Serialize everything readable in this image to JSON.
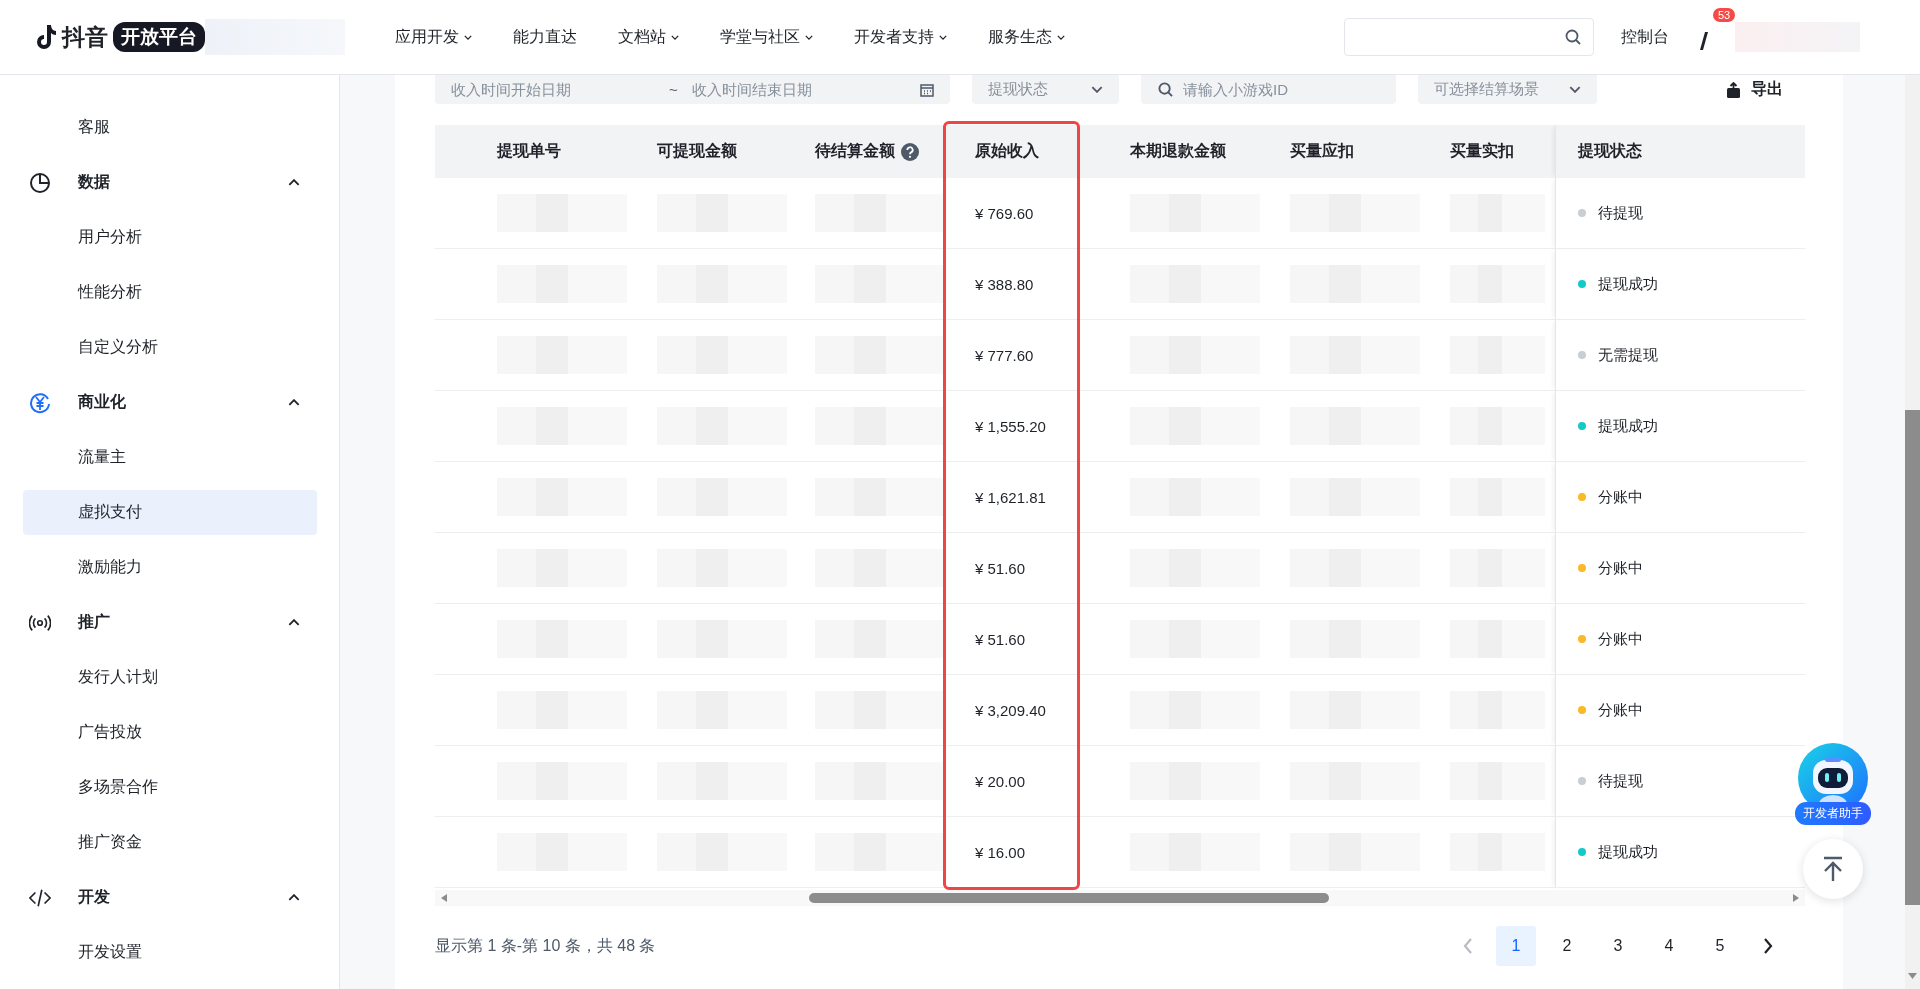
{
  "header": {
    "logo": {
      "name": "抖音",
      "badge": "开放平台"
    },
    "nav": [
      {
        "label": "应用开发",
        "dropdown": true
      },
      {
        "label": "能力直达",
        "dropdown": false
      },
      {
        "label": "文档站",
        "dropdown": true
      },
      {
        "label": "学堂与社区",
        "dropdown": true
      },
      {
        "label": "开发者支持",
        "dropdown": true
      },
      {
        "label": "服务生态",
        "dropdown": true
      }
    ],
    "console": "控制台",
    "notification_count": "53"
  },
  "sidebar": {
    "items": [
      {
        "kind": "item",
        "label": "客服",
        "selected": false
      },
      {
        "kind": "group",
        "label": "数据",
        "expanded": true
      },
      {
        "kind": "item",
        "label": "用户分析",
        "selected": false
      },
      {
        "kind": "item",
        "label": "性能分析",
        "selected": false
      },
      {
        "kind": "item",
        "label": "自定义分析",
        "selected": false
      },
      {
        "kind": "group",
        "label": "商业化",
        "expanded": true
      },
      {
        "kind": "item",
        "label": "流量主",
        "selected": false
      },
      {
        "kind": "item",
        "label": "虚拟支付",
        "selected": true
      },
      {
        "kind": "item",
        "label": "激励能力",
        "selected": false
      },
      {
        "kind": "group",
        "label": "推广",
        "expanded": true
      },
      {
        "kind": "item",
        "label": "发行人计划",
        "selected": false
      },
      {
        "kind": "item",
        "label": "广告投放",
        "selected": false
      },
      {
        "kind": "item",
        "label": "多场景合作",
        "selected": false
      },
      {
        "kind": "item",
        "label": "推广资金",
        "selected": false
      },
      {
        "kind": "group",
        "label": "开发",
        "expanded": true
      },
      {
        "kind": "item",
        "label": "开发设置",
        "selected": false
      }
    ]
  },
  "filters": {
    "start_date": {
      "placeholder": "收入时间开始日期"
    },
    "separator": "~",
    "end_date": {
      "placeholder": "收入时间结束日期"
    },
    "status_select": {
      "placeholder": "提现状态"
    },
    "game_search": {
      "placeholder": "请输入小游戏ID"
    },
    "scene_select": {
      "placeholder": "可选择结算场景"
    },
    "export": "导出"
  },
  "table": {
    "columns": [
      {
        "label": "提现单号",
        "kind": "hidden",
        "help": false,
        "highlighted": false
      },
      {
        "label": "可提现金额",
        "kind": "hidden",
        "help": false,
        "highlighted": false
      },
      {
        "label": "待结算金额",
        "kind": "hidden",
        "help": true,
        "highlighted": false
      },
      {
        "label": "原始收入",
        "kind": "amount",
        "help": false,
        "highlighted": true
      },
      {
        "label": "本期退款金额",
        "kind": "hidden",
        "help": false,
        "highlighted": false
      },
      {
        "label": "买量应扣",
        "kind": "hidden",
        "help": false,
        "highlighted": false
      },
      {
        "label": "买量实扣",
        "kind": "hidden",
        "help": false,
        "highlighted": false
      },
      {
        "label": "提现状态",
        "kind": "status",
        "help": false,
        "highlighted": false
      }
    ],
    "rows": [
      {
        "amount": "¥ 769.60",
        "status": "待提现",
        "color": "#c9cdd4"
      },
      {
        "amount": "¥ 388.80",
        "status": "提现成功",
        "color": "#14c9c9"
      },
      {
        "amount": "¥ 777.60",
        "status": "无需提现",
        "color": "#c9cdd4"
      },
      {
        "amount": "¥ 1,555.20",
        "status": "提现成功",
        "color": "#14c9c9"
      },
      {
        "amount": "¥ 1,621.81",
        "status": "分账中",
        "color": "#fbb829"
      },
      {
        "amount": "¥ 51.60",
        "status": "分账中",
        "color": "#fbb829"
      },
      {
        "amount": "¥ 51.60",
        "status": "分账中",
        "color": "#fbb829"
      },
      {
        "amount": "¥ 3,209.40",
        "status": "分账中",
        "color": "#fbb829"
      },
      {
        "amount": "¥ 20.00",
        "status": "待提现",
        "color": "#c9cdd4"
      },
      {
        "amount": "¥ 16.00",
        "status": "提现成功",
        "color": "#14c9c9"
      }
    ]
  },
  "footer": {
    "summary": "显示第 1 条-第 10 条，共 48 条",
    "prev": {
      "disabled": true
    },
    "next": {
      "disabled": false
    },
    "pages": [
      {
        "label": "1",
        "selected": true
      },
      {
        "label": "2",
        "selected": false
      },
      {
        "label": "3",
        "selected": false
      },
      {
        "label": "4",
        "selected": false
      },
      {
        "label": "5",
        "selected": false
      }
    ]
  },
  "assistant": {
    "label": "开发者助手"
  }
}
